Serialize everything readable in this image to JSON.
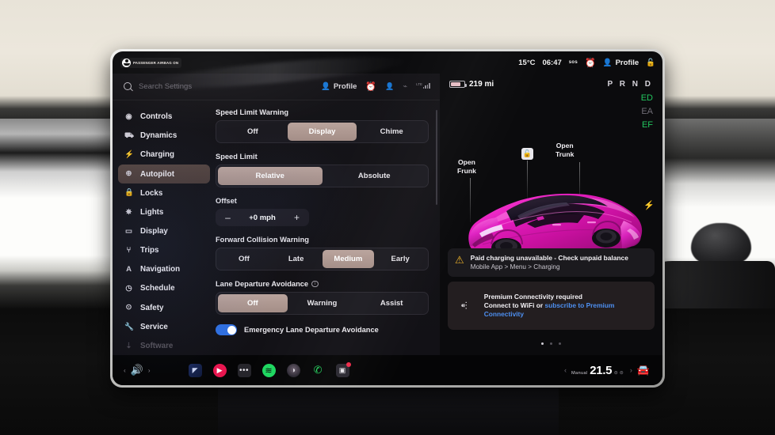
{
  "statusbar": {
    "airbag_label": "PASSENGER AIRBAG ON",
    "temperature": "15°C",
    "clock": "06:47",
    "sos_label": "sos",
    "alarm_icon": "alarm-icon",
    "profile_label": "Profile",
    "lock_icon": "lock-icon"
  },
  "settings": {
    "search": {
      "placeholder": "Search Settings",
      "icon": "search-icon"
    },
    "header": {
      "profile_label": "Profile",
      "alarm_icon": "alarm-icon",
      "bluetooth_icon": "bluetooth-icon",
      "person_icon": "person-icon",
      "signal_icon": "signal-bars-icon",
      "network_label": "LTE"
    },
    "sidebar": {
      "items": [
        {
          "label": "Controls",
          "icon": "controls-icon",
          "glyph": "◉",
          "active": false,
          "dim": false
        },
        {
          "label": "Dynamics",
          "icon": "dynamics-icon",
          "glyph": "⛟",
          "active": false,
          "dim": false
        },
        {
          "label": "Charging",
          "icon": "charging-icon",
          "glyph": "⚡",
          "active": false,
          "dim": false
        },
        {
          "label": "Autopilot",
          "icon": "autopilot-icon",
          "glyph": "⊕",
          "active": true,
          "dim": false
        },
        {
          "label": "Locks",
          "icon": "lock-icon",
          "glyph": "🔒",
          "active": false,
          "dim": false
        },
        {
          "label": "Lights",
          "icon": "lights-icon",
          "glyph": "✵",
          "active": false,
          "dim": false
        },
        {
          "label": "Display",
          "icon": "display-icon",
          "glyph": "▭",
          "active": false,
          "dim": false
        },
        {
          "label": "Trips",
          "icon": "trips-icon",
          "glyph": "⑂",
          "active": false,
          "dim": false
        },
        {
          "label": "Navigation",
          "icon": "navigation-icon",
          "glyph": "A",
          "active": false,
          "dim": false
        },
        {
          "label": "Schedule",
          "icon": "schedule-icon",
          "glyph": "◷",
          "active": false,
          "dim": false
        },
        {
          "label": "Safety",
          "icon": "safety-icon",
          "glyph": "⊙",
          "active": false,
          "dim": false
        },
        {
          "label": "Service",
          "icon": "service-icon",
          "glyph": "🔧",
          "active": false,
          "dim": false
        },
        {
          "label": "Software",
          "icon": "software-icon",
          "glyph": "⇣",
          "active": false,
          "dim": true
        }
      ]
    },
    "panel": {
      "speed_limit_warning": {
        "label": "Speed Limit Warning",
        "options": [
          "Off",
          "Display",
          "Chime"
        ],
        "selected": "Display"
      },
      "speed_limit": {
        "label": "Speed Limit",
        "options": [
          "Relative",
          "Absolute"
        ],
        "selected": "Relative"
      },
      "offset": {
        "label": "Offset",
        "value": "+0 mph",
        "decrement": "–",
        "increment": "+"
      },
      "forward_collision_warning": {
        "label": "Forward Collision Warning",
        "options": [
          "Off",
          "Late",
          "Medium",
          "Early"
        ],
        "selected": "Medium"
      },
      "lane_departure_avoidance": {
        "label": "Lane Departure Avoidance",
        "info_icon": "info-icon",
        "options": [
          "Off",
          "Warning",
          "Assist"
        ],
        "selected": "Off"
      },
      "emergency_lane_departure": {
        "label": "Emergency Lane Departure Avoidance",
        "enabled": true
      }
    }
  },
  "vehicle": {
    "range": "219 mi",
    "gear": "P R N D",
    "indicators": [
      {
        "icon": "headlight-icon",
        "glyph": "ED",
        "state": "green"
      },
      {
        "icon": "auto-headlight-icon",
        "glyph": "EA",
        "state": "gray"
      },
      {
        "icon": "fog-light-icon",
        "glyph": "EF",
        "state": "green"
      }
    ],
    "labels": {
      "frunk": "Open\nFrunk",
      "frunk_line1": "Open",
      "frunk_line2": "Frunk",
      "trunk_line1": "Open",
      "trunk_line2": "Trunk",
      "lock_icon": "unlock-icon",
      "charge_port_icon": "charge-port-icon"
    },
    "car_color": "#e61ec0",
    "notifications": [
      {
        "icon": "warning-triangle-icon",
        "title": "Paid charging unavailable - Check unpaid balance",
        "subtitle": "Mobile App > Menu > Charging"
      },
      {
        "icon": "no-signal-icon",
        "title": "Premium Connectivity required",
        "line_prefix": "Connect to WiFi or ",
        "link_text": "subscribe to Premium Connectivity"
      }
    ],
    "page_dots": {
      "count": 3,
      "active": 0
    }
  },
  "dock": {
    "volume_icon": "volume-icon",
    "prev_icon": "chevron-left-icon",
    "next_icon": "chevron-right-icon",
    "apps": [
      {
        "name": "navigation-app",
        "glyph": "◤"
      },
      {
        "name": "media-app",
        "glyph": "▶"
      },
      {
        "name": "more-apps",
        "glyph": "•••"
      },
      {
        "name": "spotify-app",
        "glyph": "≋"
      },
      {
        "name": "tidal-app",
        "glyph": "◑"
      },
      {
        "name": "phone-app",
        "glyph": "✆"
      },
      {
        "name": "camera-app",
        "glyph": "▣",
        "badge": true
      }
    ],
    "climate": {
      "mode": "Manual",
      "temperature": "21.5",
      "prev_icon": "chevron-left-icon",
      "next_icon": "chevron-right-icon",
      "seat_icons": "seat-heater-icon"
    },
    "car_icon": "car-icon"
  }
}
